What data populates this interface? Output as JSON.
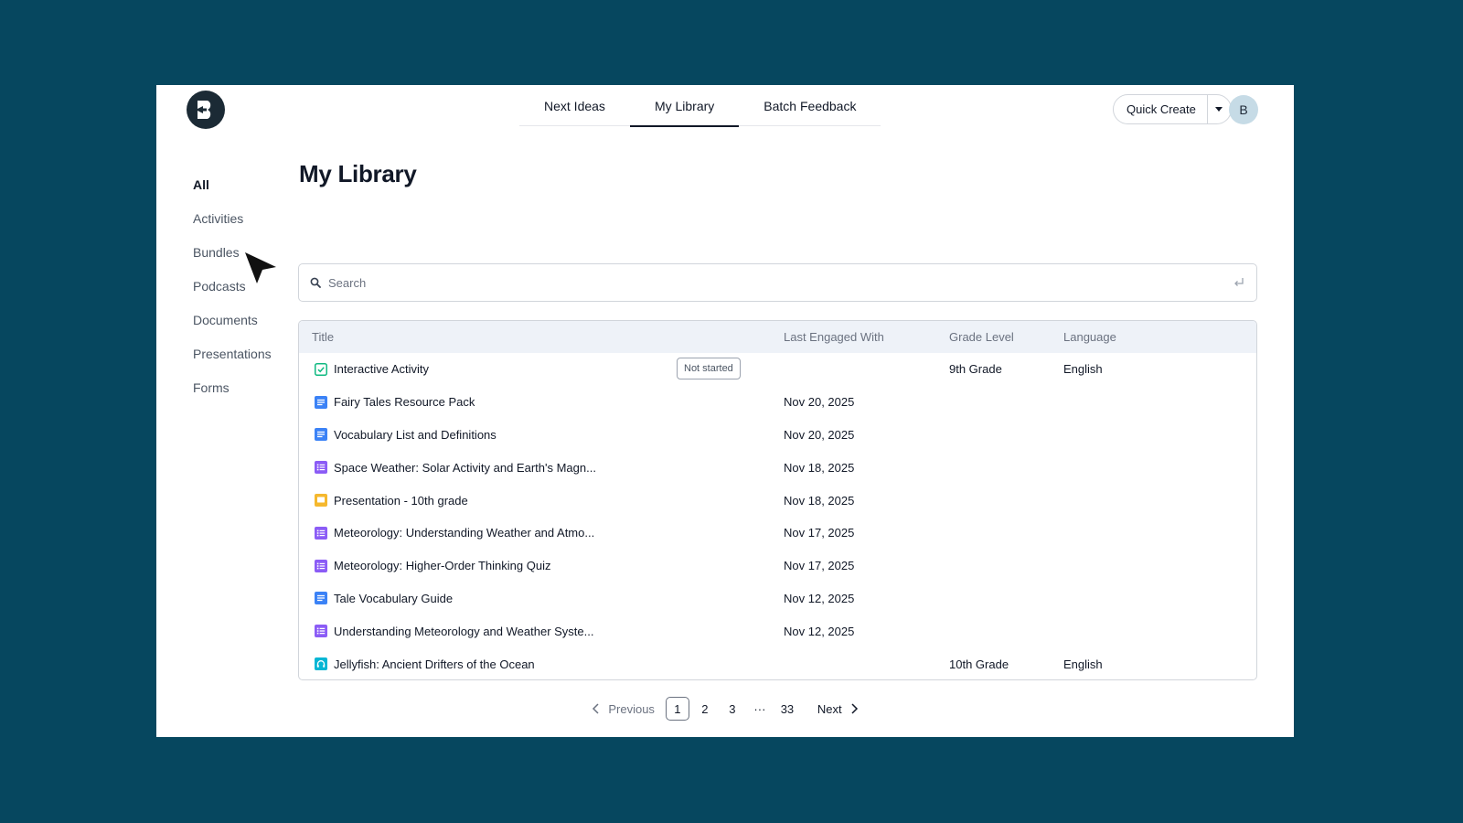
{
  "nav": {
    "tabs": [
      {
        "label": "Next Ideas"
      },
      {
        "label": "My Library"
      },
      {
        "label": "Batch Feedback"
      }
    ],
    "active_tab": 1
  },
  "header": {
    "quick_create_label": "Quick Create",
    "avatar_initial": "B"
  },
  "sidebar": {
    "items": [
      {
        "label": "All"
      },
      {
        "label": "Activities"
      },
      {
        "label": "Bundles"
      },
      {
        "label": "Podcasts"
      },
      {
        "label": "Documents"
      },
      {
        "label": "Presentations"
      },
      {
        "label": "Forms"
      }
    ]
  },
  "page": {
    "title": "My Library"
  },
  "search": {
    "placeholder": "Search"
  },
  "table": {
    "columns": [
      "Title",
      "Last Engaged With",
      "Grade Level",
      "Language"
    ],
    "rows": [
      {
        "icon": "activity-icon",
        "title": "Interactive Activity",
        "badge": "Not started",
        "date": "",
        "grade": "9th Grade",
        "language": "English"
      },
      {
        "icon": "document-icon",
        "title": "Fairy Tales Resource Pack",
        "date": "Nov 20, 2025",
        "grade": "",
        "language": ""
      },
      {
        "icon": "document-icon",
        "title": "Vocabulary List and Definitions",
        "date": "Nov 20, 2025",
        "grade": "",
        "language": ""
      },
      {
        "icon": "form-icon",
        "title": "Space Weather: Solar Activity and Earth's Magn...",
        "date": "Nov 18, 2025",
        "grade": "",
        "language": ""
      },
      {
        "icon": "presentation-icon",
        "title": "Presentation - 10th grade",
        "date": "Nov 18, 2025",
        "grade": "",
        "language": ""
      },
      {
        "icon": "form-icon",
        "title": "Meteorology: Understanding Weather and Atmo...",
        "date": "Nov 17, 2025",
        "grade": "",
        "language": ""
      },
      {
        "icon": "form-icon",
        "title": "Meteorology: Higher-Order Thinking Quiz",
        "date": "Nov 17, 2025",
        "grade": "",
        "language": ""
      },
      {
        "icon": "document-icon",
        "title": "Tale Vocabulary Guide",
        "date": "Nov 12, 2025",
        "grade": "",
        "language": ""
      },
      {
        "icon": "form-icon",
        "title": "Understanding Meteorology and Weather Syste...",
        "date": "Nov 12, 2025",
        "grade": "",
        "language": ""
      },
      {
        "icon": "podcast-icon",
        "title": "Jellyfish: Ancient Drifters of the Ocean",
        "date": "",
        "grade": "10th Grade",
        "language": "English"
      }
    ]
  },
  "pagination": {
    "prev_label": "Previous",
    "next_label": "Next",
    "pages": [
      "1",
      "2",
      "3"
    ],
    "ellipsis": "···",
    "last_page": "33",
    "current": "1"
  },
  "colors": {
    "background": "#06475f",
    "activity": "#10b981",
    "document": "#3b82f6",
    "form": "#8b5cf6",
    "presentation": "#f5b82e",
    "podcast": "#06b6d4"
  }
}
